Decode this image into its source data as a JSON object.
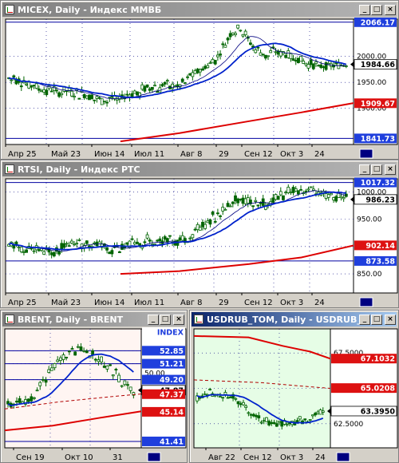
{
  "colors": {
    "grid": "#000080",
    "price": "#006400",
    "ma_blue": "#0022cc",
    "ma_red": "#dd0000",
    "label_blue": "#1f3fdd",
    "label_red": "#dd1111",
    "label_black": "#000000"
  },
  "windows": {
    "micex": {
      "title": "MICEX, Daily - Индекс ММВБ",
      "x_labels": [
        "Апр 25",
        "Май 23",
        "Июн 14",
        "Июл 11",
        "Авг 8",
        "29",
        "Сен 12",
        "Окт 3",
        "24"
      ],
      "y_ticks": [
        "2000.00",
        "1950.00",
        "1900.00"
      ],
      "labels": [
        {
          "text": "2066.17",
          "style": "blue",
          "value": 2066.17
        },
        {
          "text": "1984.66",
          "style": "current",
          "value": 1984.66
        },
        {
          "text": "1909.67",
          "style": "red",
          "value": 1909.67
        },
        {
          "text": "1841.73",
          "style": "blue",
          "value": 1841.73
        }
      ],
      "hlines": [
        2066.17,
        1841.73
      ]
    },
    "rtsi": {
      "title": "RTSI, Daily - Индекс РТС",
      "x_labels": [
        "Апр 25",
        "Май 23",
        "Июн 14",
        "Июл 11",
        "Авг 8",
        "29",
        "Сен 12",
        "Окт 3",
        "24"
      ],
      "y_ticks": [
        "1000.00",
        "950.00",
        "850.00"
      ],
      "labels": [
        {
          "text": "1017.32",
          "style": "blue",
          "value": 1017.32
        },
        {
          "text": "986.23",
          "style": "current",
          "value": 986.23
        },
        {
          "text": "902.14",
          "style": "red",
          "value": 902.14
        },
        {
          "text": "873.58",
          "style": "blue",
          "value": 873.58
        }
      ],
      "hlines": [
        1017.32,
        873.58
      ]
    },
    "brent": {
      "title": "BRENT, Daily - BRENT",
      "x_labels": [
        "Сен 19",
        "Окт 10",
        "31"
      ],
      "y_ticks": [
        "50.00"
      ],
      "labels": [
        {
          "text": "INDEX",
          "style": "index",
          "value": 55.2
        },
        {
          "text": "52.85",
          "style": "blue",
          "value": 52.85
        },
        {
          "text": "51.21",
          "style": "blue",
          "value": 51.21
        },
        {
          "text": "49.20",
          "style": "blue",
          "value": 49.2
        },
        {
          "text": "47.87",
          "style": "current",
          "value": 47.87
        },
        {
          "text": "47.37",
          "style": "red",
          "value": 47.37
        },
        {
          "text": "45.14",
          "style": "red",
          "value": 45.14
        },
        {
          "text": "41.41",
          "style": "blue",
          "value": 41.41
        }
      ],
      "hlines": [
        52.85,
        51.21,
        49.2,
        41.41
      ]
    },
    "usdrub": {
      "title": "USDRUB_TOM, Daily - USDRUB_...",
      "x_labels": [
        "Авг 22",
        "Сен 12",
        "Окт 3",
        "24"
      ],
      "y_ticks": [
        "67.5000",
        "62.5000"
      ],
      "labels": [
        {
          "text": "67.1032",
          "style": "red",
          "value": 67.1032
        },
        {
          "text": "65.0208",
          "style": "red",
          "value": 65.0208
        },
        {
          "text": "63.3950",
          "style": "current",
          "value": 63.395
        }
      ],
      "hlines": []
    }
  }
}
